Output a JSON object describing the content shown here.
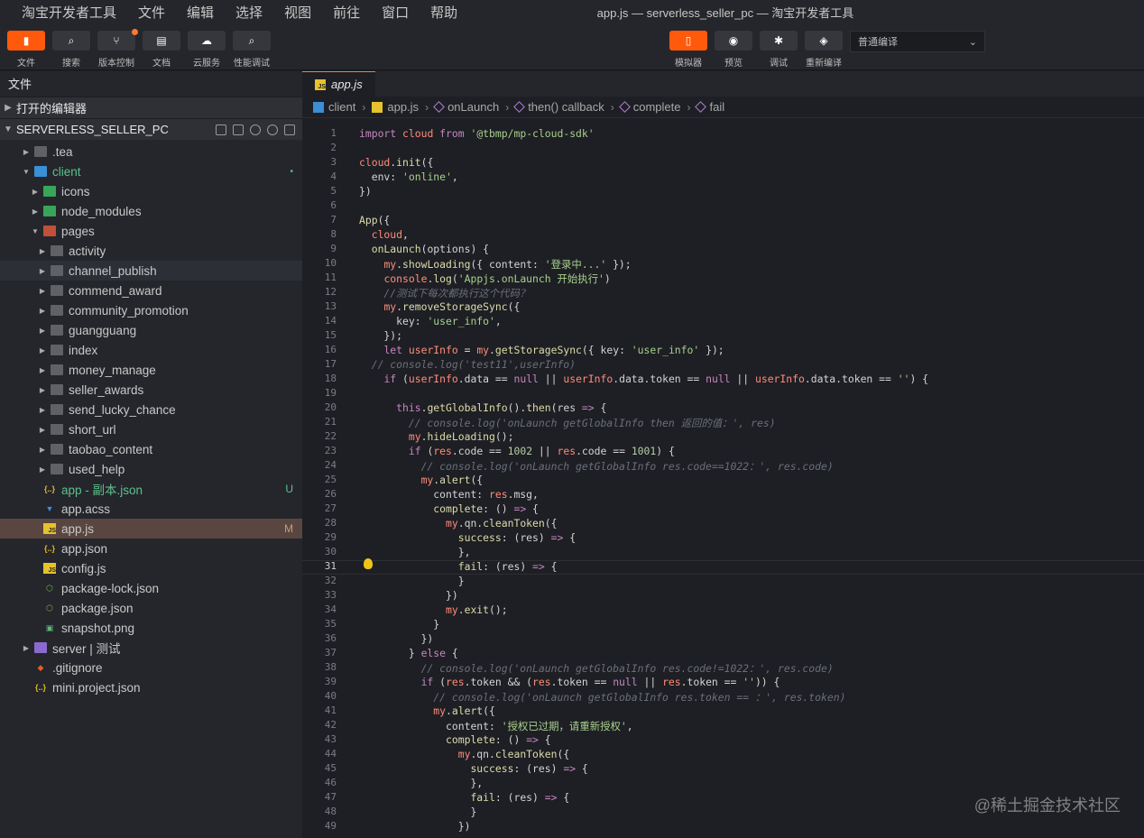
{
  "menubar": {
    "items": [
      "淘宝开发者工具",
      "文件",
      "编辑",
      "选择",
      "视图",
      "前往",
      "窗口",
      "帮助"
    ],
    "window_title": "app.js — serverless_seller_pc — 淘宝开发者工具"
  },
  "toolbar": {
    "left": [
      {
        "label": "文件",
        "icon": "file-icon",
        "active": true
      },
      {
        "label": "搜索",
        "icon": "search-icon",
        "active": false
      },
      {
        "label": "版本控制",
        "icon": "git-branch-icon",
        "active": false,
        "dot": true
      },
      {
        "label": "文档",
        "icon": "document-icon",
        "active": false
      },
      {
        "label": "云服务",
        "icon": "cloud-icon",
        "active": false
      },
      {
        "label": "性能调试",
        "icon": "performance-icon",
        "active": false
      }
    ],
    "right": [
      {
        "label": "模拟器",
        "icon": "phone-icon",
        "active": true
      },
      {
        "label": "预览",
        "icon": "eye-icon",
        "active": false
      },
      {
        "label": "调试",
        "icon": "bug-icon",
        "active": false
      },
      {
        "label": "重新编译",
        "icon": "layers-icon",
        "active": false
      }
    ],
    "compile_mode": "普通编译"
  },
  "sidebar": {
    "title": "文件",
    "open_editors": "打开的编辑器",
    "project": "SERVERLESS_SELLER_PC",
    "tree": [
      {
        "name": ".tea",
        "depth": 1,
        "type": "folder",
        "expanded": false
      },
      {
        "name": "client",
        "depth": 1,
        "type": "folder-blue",
        "expanded": true,
        "badge": "•",
        "badgeType": "dot",
        "green": true
      },
      {
        "name": "icons",
        "depth": 2,
        "type": "folder-green",
        "expanded": false
      },
      {
        "name": "node_modules",
        "depth": 2,
        "type": "folder-green",
        "expanded": false
      },
      {
        "name": "pages",
        "depth": 2,
        "type": "folder-red",
        "expanded": true
      },
      {
        "name": "activity",
        "depth": 3,
        "type": "folder",
        "expanded": false
      },
      {
        "name": "channel_publish",
        "depth": 3,
        "type": "folder",
        "expanded": false,
        "hover": true
      },
      {
        "name": "commend_award",
        "depth": 3,
        "type": "folder",
        "expanded": false
      },
      {
        "name": "community_promotion",
        "depth": 3,
        "type": "folder",
        "expanded": false
      },
      {
        "name": "guangguang",
        "depth": 3,
        "type": "folder",
        "expanded": false
      },
      {
        "name": "index",
        "depth": 3,
        "type": "folder",
        "expanded": false
      },
      {
        "name": "money_manage",
        "depth": 3,
        "type": "folder",
        "expanded": false
      },
      {
        "name": "seller_awards",
        "depth": 3,
        "type": "folder",
        "expanded": false
      },
      {
        "name": "send_lucky_chance",
        "depth": 3,
        "type": "folder",
        "expanded": false
      },
      {
        "name": "short_url",
        "depth": 3,
        "type": "folder",
        "expanded": false
      },
      {
        "name": "taobao_content",
        "depth": 3,
        "type": "folder",
        "expanded": false
      },
      {
        "name": "used_help",
        "depth": 3,
        "type": "folder",
        "expanded": false
      },
      {
        "name": "app - 副本.json",
        "depth": 2,
        "type": "json",
        "badge": "U",
        "badgeType": "u",
        "green": true
      },
      {
        "name": "app.acss",
        "depth": 2,
        "type": "css"
      },
      {
        "name": "app.js",
        "depth": 2,
        "type": "js",
        "badge": "M",
        "badgeType": "m",
        "selected": true
      },
      {
        "name": "app.json",
        "depth": 2,
        "type": "json"
      },
      {
        "name": "config.js",
        "depth": 2,
        "type": "js"
      },
      {
        "name": "package-lock.json",
        "depth": 2,
        "type": "npm"
      },
      {
        "name": "package.json",
        "depth": 2,
        "type": "npm"
      },
      {
        "name": "snapshot.png",
        "depth": 2,
        "type": "img"
      },
      {
        "name": "server | 测试",
        "depth": 1,
        "type": "folder-purple",
        "expanded": false
      },
      {
        "name": ".gitignore",
        "depth": 1,
        "type": "git"
      },
      {
        "name": "mini.project.json",
        "depth": 1,
        "type": "json"
      }
    ]
  },
  "editor": {
    "tab": "app.js",
    "breadcrumbs": [
      "client",
      "app.js",
      "onLaunch",
      "then() callback",
      "complete",
      "fail"
    ],
    "current_line": 31,
    "lines": [
      [
        [
          "k",
          "import "
        ],
        [
          "v",
          "cloud "
        ],
        [
          "k",
          "from "
        ],
        [
          "s",
          "'@tbmp/mp-cloud-sdk'"
        ]
      ],
      [],
      [
        [
          "v",
          "cloud"
        ],
        [
          "p",
          "."
        ],
        [
          "fn",
          "init"
        ],
        [
          "p",
          "({"
        ]
      ],
      [
        [
          "p",
          "  env: "
        ],
        [
          "s",
          "'online'"
        ],
        [
          "p",
          ","
        ]
      ],
      [
        [
          "p",
          "})"
        ]
      ],
      [],
      [
        [
          "fn",
          "App"
        ],
        [
          "p",
          "({"
        ]
      ],
      [
        [
          "p",
          "  "
        ],
        [
          "v",
          "cloud"
        ],
        [
          "p",
          ","
        ]
      ],
      [
        [
          "p",
          "  "
        ],
        [
          "fn",
          "onLaunch"
        ],
        [
          "p",
          "(options) {"
        ]
      ],
      [
        [
          "p",
          "    "
        ],
        [
          "v",
          "my"
        ],
        [
          "p",
          "."
        ],
        [
          "fn",
          "showLoading"
        ],
        [
          "p",
          "({ content: "
        ],
        [
          "s",
          "'登录中...'"
        ],
        [
          "p",
          " });"
        ]
      ],
      [
        [
          "p",
          "    "
        ],
        [
          "v",
          "console"
        ],
        [
          "p",
          "."
        ],
        [
          "fn",
          "log"
        ],
        [
          "p",
          "("
        ],
        [
          "s",
          "'Appjs.onLaunch 开始执行'"
        ],
        [
          "p",
          ")"
        ]
      ],
      [
        [
          "cm",
          "    //测试下每次都执行这个代码？"
        ]
      ],
      [
        [
          "p",
          "    "
        ],
        [
          "v",
          "my"
        ],
        [
          "p",
          "."
        ],
        [
          "fn",
          "removeStorageSync"
        ],
        [
          "p",
          "({"
        ]
      ],
      [
        [
          "p",
          "      key: "
        ],
        [
          "s",
          "'user_info'"
        ],
        [
          "p",
          ","
        ]
      ],
      [
        [
          "p",
          "    });"
        ]
      ],
      [
        [
          "p",
          "    "
        ],
        [
          "k",
          "let "
        ],
        [
          "v",
          "userInfo "
        ],
        [
          "p",
          "= "
        ],
        [
          "v",
          "my"
        ],
        [
          "p",
          "."
        ],
        [
          "fn",
          "getStorageSync"
        ],
        [
          "p",
          "({ key: "
        ],
        [
          "s",
          "'user_info'"
        ],
        [
          "p",
          " });"
        ]
      ],
      [
        [
          "cm",
          "  // console.log('test11',userInfo)"
        ]
      ],
      [
        [
          "p",
          "    "
        ],
        [
          "k",
          "if "
        ],
        [
          "p",
          "("
        ],
        [
          "v",
          "userInfo"
        ],
        [
          "p",
          ".data == "
        ],
        [
          "k",
          "null "
        ],
        [
          "p",
          "|| "
        ],
        [
          "v",
          "userInfo"
        ],
        [
          "p",
          ".data.token == "
        ],
        [
          "k",
          "null "
        ],
        [
          "p",
          "|| "
        ],
        [
          "v",
          "userInfo"
        ],
        [
          "p",
          ".data.token == "
        ],
        [
          "s",
          "''"
        ],
        [
          "p",
          ") {"
        ]
      ],
      [],
      [
        [
          "p",
          "      "
        ],
        [
          "k",
          "this"
        ],
        [
          "p",
          "."
        ],
        [
          "fn",
          "getGlobalInfo"
        ],
        [
          "p",
          "()."
        ],
        [
          "fn",
          "then"
        ],
        [
          "p",
          "(res "
        ],
        [
          "k",
          "=>"
        ],
        [
          "p",
          " {"
        ]
      ],
      [
        [
          "cm",
          "        // console.log('onLaunch getGlobalInfo then 返回的值：', res)"
        ]
      ],
      [
        [
          "p",
          "        "
        ],
        [
          "v",
          "my"
        ],
        [
          "p",
          "."
        ],
        [
          "fn",
          "hideLoading"
        ],
        [
          "p",
          "();"
        ]
      ],
      [
        [
          "p",
          "        "
        ],
        [
          "k",
          "if "
        ],
        [
          "p",
          "("
        ],
        [
          "v",
          "res"
        ],
        [
          "p",
          ".code == "
        ],
        [
          "n",
          "1002 "
        ],
        [
          "p",
          "|| "
        ],
        [
          "v",
          "res"
        ],
        [
          "p",
          ".code == "
        ],
        [
          "n",
          "1001"
        ],
        [
          "p",
          ") {"
        ]
      ],
      [
        [
          "cm",
          "          // console.log('onLaunch getGlobalInfo res.code==1022：', res.code)"
        ]
      ],
      [
        [
          "p",
          "          "
        ],
        [
          "v",
          "my"
        ],
        [
          "p",
          "."
        ],
        [
          "fn",
          "alert"
        ],
        [
          "p",
          "({"
        ]
      ],
      [
        [
          "p",
          "            content: "
        ],
        [
          "v",
          "res"
        ],
        [
          "p",
          ".msg,"
        ]
      ],
      [
        [
          "p",
          "            "
        ],
        [
          "fn",
          "complete"
        ],
        [
          "p",
          ": () "
        ],
        [
          "k",
          "=>"
        ],
        [
          "p",
          " {"
        ]
      ],
      [
        [
          "p",
          "              "
        ],
        [
          "v",
          "my"
        ],
        [
          "p",
          ".qn."
        ],
        [
          "fn",
          "cleanToken"
        ],
        [
          "p",
          "({"
        ]
      ],
      [
        [
          "p",
          "                "
        ],
        [
          "fn",
          "success"
        ],
        [
          "p",
          ": (res) "
        ],
        [
          "k",
          "=>"
        ],
        [
          "p",
          " {"
        ]
      ],
      [
        [
          "p",
          "                },"
        ]
      ],
      [
        [
          "p",
          "                "
        ],
        [
          "fn",
          "fail"
        ],
        [
          "p",
          ": (res) "
        ],
        [
          "k",
          "=>"
        ],
        [
          "p",
          " {"
        ]
      ],
      [
        [
          "p",
          "                }"
        ]
      ],
      [
        [
          "p",
          "              })"
        ]
      ],
      [
        [
          "p",
          "              "
        ],
        [
          "v",
          "my"
        ],
        [
          "p",
          "."
        ],
        [
          "fn",
          "exit"
        ],
        [
          "p",
          "();"
        ]
      ],
      [
        [
          "p",
          "            }"
        ]
      ],
      [
        [
          "p",
          "          })"
        ]
      ],
      [
        [
          "p",
          "        } "
        ],
        [
          "k",
          "else "
        ],
        [
          "p",
          "{"
        ]
      ],
      [
        [
          "cm",
          "          // console.log('onLaunch getGlobalInfo res.code!=1022：', res.code)"
        ]
      ],
      [
        [
          "p",
          "          "
        ],
        [
          "k",
          "if "
        ],
        [
          "p",
          "("
        ],
        [
          "v",
          "res"
        ],
        [
          "p",
          ".token && ("
        ],
        [
          "v",
          "res"
        ],
        [
          "p",
          ".token == "
        ],
        [
          "k",
          "null "
        ],
        [
          "p",
          "|| "
        ],
        [
          "v",
          "res"
        ],
        [
          "p",
          ".token == "
        ],
        [
          "s",
          "''"
        ],
        [
          "p",
          ")) {"
        ]
      ],
      [
        [
          "cm",
          "            // console.log('onLaunch getGlobalInfo res.token == ：', res.token)"
        ]
      ],
      [
        [
          "p",
          "            "
        ],
        [
          "v",
          "my"
        ],
        [
          "p",
          "."
        ],
        [
          "fn",
          "alert"
        ],
        [
          "p",
          "({"
        ]
      ],
      [
        [
          "p",
          "              content: "
        ],
        [
          "s",
          "'授权已过期，请重新授权'"
        ],
        [
          "p",
          ","
        ]
      ],
      [
        [
          "p",
          "              "
        ],
        [
          "fn",
          "complete"
        ],
        [
          "p",
          ": () "
        ],
        [
          "k",
          "=>"
        ],
        [
          "p",
          " {"
        ]
      ],
      [
        [
          "p",
          "                "
        ],
        [
          "v",
          "my"
        ],
        [
          "p",
          ".qn."
        ],
        [
          "fn",
          "cleanToken"
        ],
        [
          "p",
          "({"
        ]
      ],
      [
        [
          "p",
          "                  "
        ],
        [
          "fn",
          "success"
        ],
        [
          "p",
          ": (res) "
        ],
        [
          "k",
          "=>"
        ],
        [
          "p",
          " {"
        ]
      ],
      [
        [
          "p",
          "                  },"
        ]
      ],
      [
        [
          "p",
          "                  "
        ],
        [
          "fn",
          "fail"
        ],
        [
          "p",
          ": (res) "
        ],
        [
          "k",
          "=>"
        ],
        [
          "p",
          " {"
        ]
      ],
      [
        [
          "p",
          "                  }"
        ]
      ],
      [
        [
          "p",
          "                })"
        ]
      ]
    ]
  },
  "watermark": "@稀土掘金技术社区"
}
